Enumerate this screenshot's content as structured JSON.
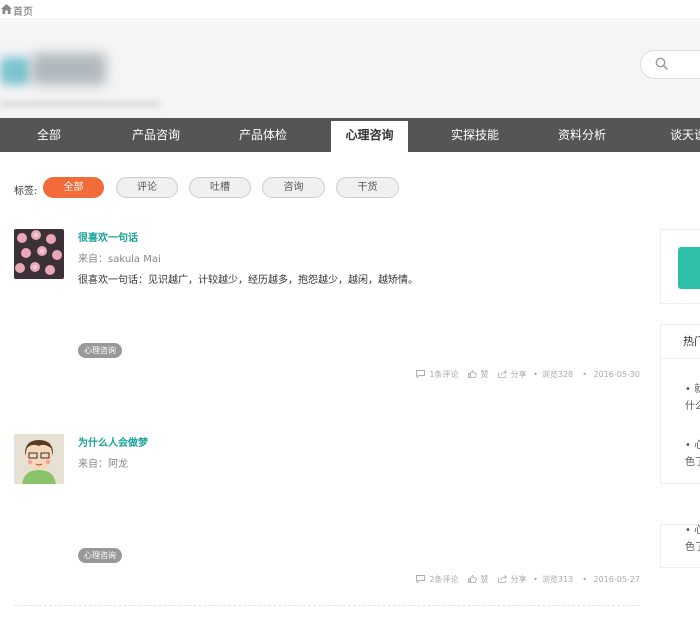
{
  "breadcrumb": {
    "home_label": "首页"
  },
  "nav": {
    "tabs": [
      {
        "label": "全部",
        "active": false
      },
      {
        "label": "产品咨询",
        "active": false
      },
      {
        "label": "产品体检",
        "active": false
      },
      {
        "label": "心理咨询",
        "active": true
      },
      {
        "label": "实探技能",
        "active": false
      },
      {
        "label": "资料分析",
        "active": false
      },
      {
        "label": "谈天说",
        "active": false
      }
    ]
  },
  "filter": {
    "label": "标签:",
    "options": [
      {
        "label": "全部",
        "active": true
      },
      {
        "label": "评论",
        "active": false
      },
      {
        "label": "吐槽",
        "active": false
      },
      {
        "label": "咨询",
        "active": false
      },
      {
        "label": "干货",
        "active": false
      }
    ]
  },
  "posts": [
    {
      "title": "很喜欢一句话",
      "source": "来自：sakula Mai",
      "body": "很喜欢一句话：见识越广，计较越少，经历越多，抱怨越少，越闲，越矫情。",
      "tag": "心理咨询",
      "comments": "1条评论",
      "likes": "赞",
      "share": "分享",
      "views": "浏览328",
      "date": "2016-05-30"
    },
    {
      "title": "为什么人会做梦",
      "source": "来自：阿龙",
      "body": "",
      "tag": "心理咨询",
      "comments": "2条评论",
      "likes": "赞",
      "share": "分享",
      "views": "浏览313",
      "date": "2016-05-27"
    }
  ],
  "sidebar": {
    "hot_title": "热门",
    "lines": [
      "• 就",
      "什么",
      "• 心",
      "色了",
      "• 心",
      "色了"
    ]
  },
  "colors": {
    "accent": "#f26b3a",
    "teal": "#1aa39a",
    "nav_bg": "#555555"
  }
}
